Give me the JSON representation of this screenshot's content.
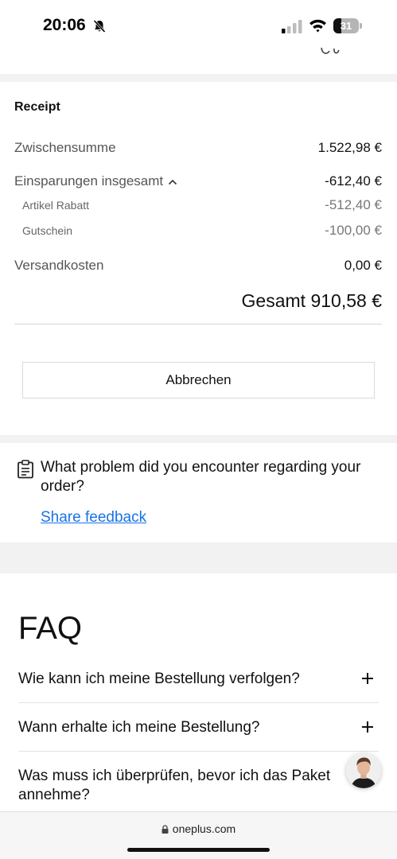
{
  "status_bar": {
    "time": "20:06",
    "battery": "31",
    "battery_level": 0.31
  },
  "receipt": {
    "title": "Receipt",
    "subtotal_label": "Zwischensumme",
    "subtotal_value": "1.522,98 €",
    "savings_label": "Einsparungen insgesamt",
    "savings_value": "-612,40 €",
    "article_discount_label": "Artikel Rabatt",
    "article_discount_value": "-512,40 €",
    "voucher_label": "Gutschein",
    "voucher_value": "-100,00 €",
    "shipping_label": "Versandkosten",
    "shipping_value": "0,00 €",
    "total": "Gesamt 910,58 €"
  },
  "cancel_label": "Abbrechen",
  "feedback": {
    "question": "What problem did you encounter regarding your order?",
    "link": "Share feedback"
  },
  "faq": {
    "title": "FAQ",
    "items": [
      {
        "question": "Wie kann ich meine Bestellung verfolgen?"
      },
      {
        "question": "Wann erhalte ich meine Bestellung?"
      },
      {
        "question": "Was muss ich überprüfen, bevor ich das Paket annehme?"
      }
    ]
  },
  "browser": {
    "url": "oneplus.com"
  },
  "colors": {
    "link": "#1a73e8",
    "band": "#f2f2f2",
    "text": "#1a1a1a"
  },
  "icons": [
    "bell-muted-icon",
    "signal-icon",
    "wifi-icon",
    "battery-icon",
    "caret-up-icon",
    "clipboard-icon",
    "plus-icon",
    "lock-icon"
  ]
}
